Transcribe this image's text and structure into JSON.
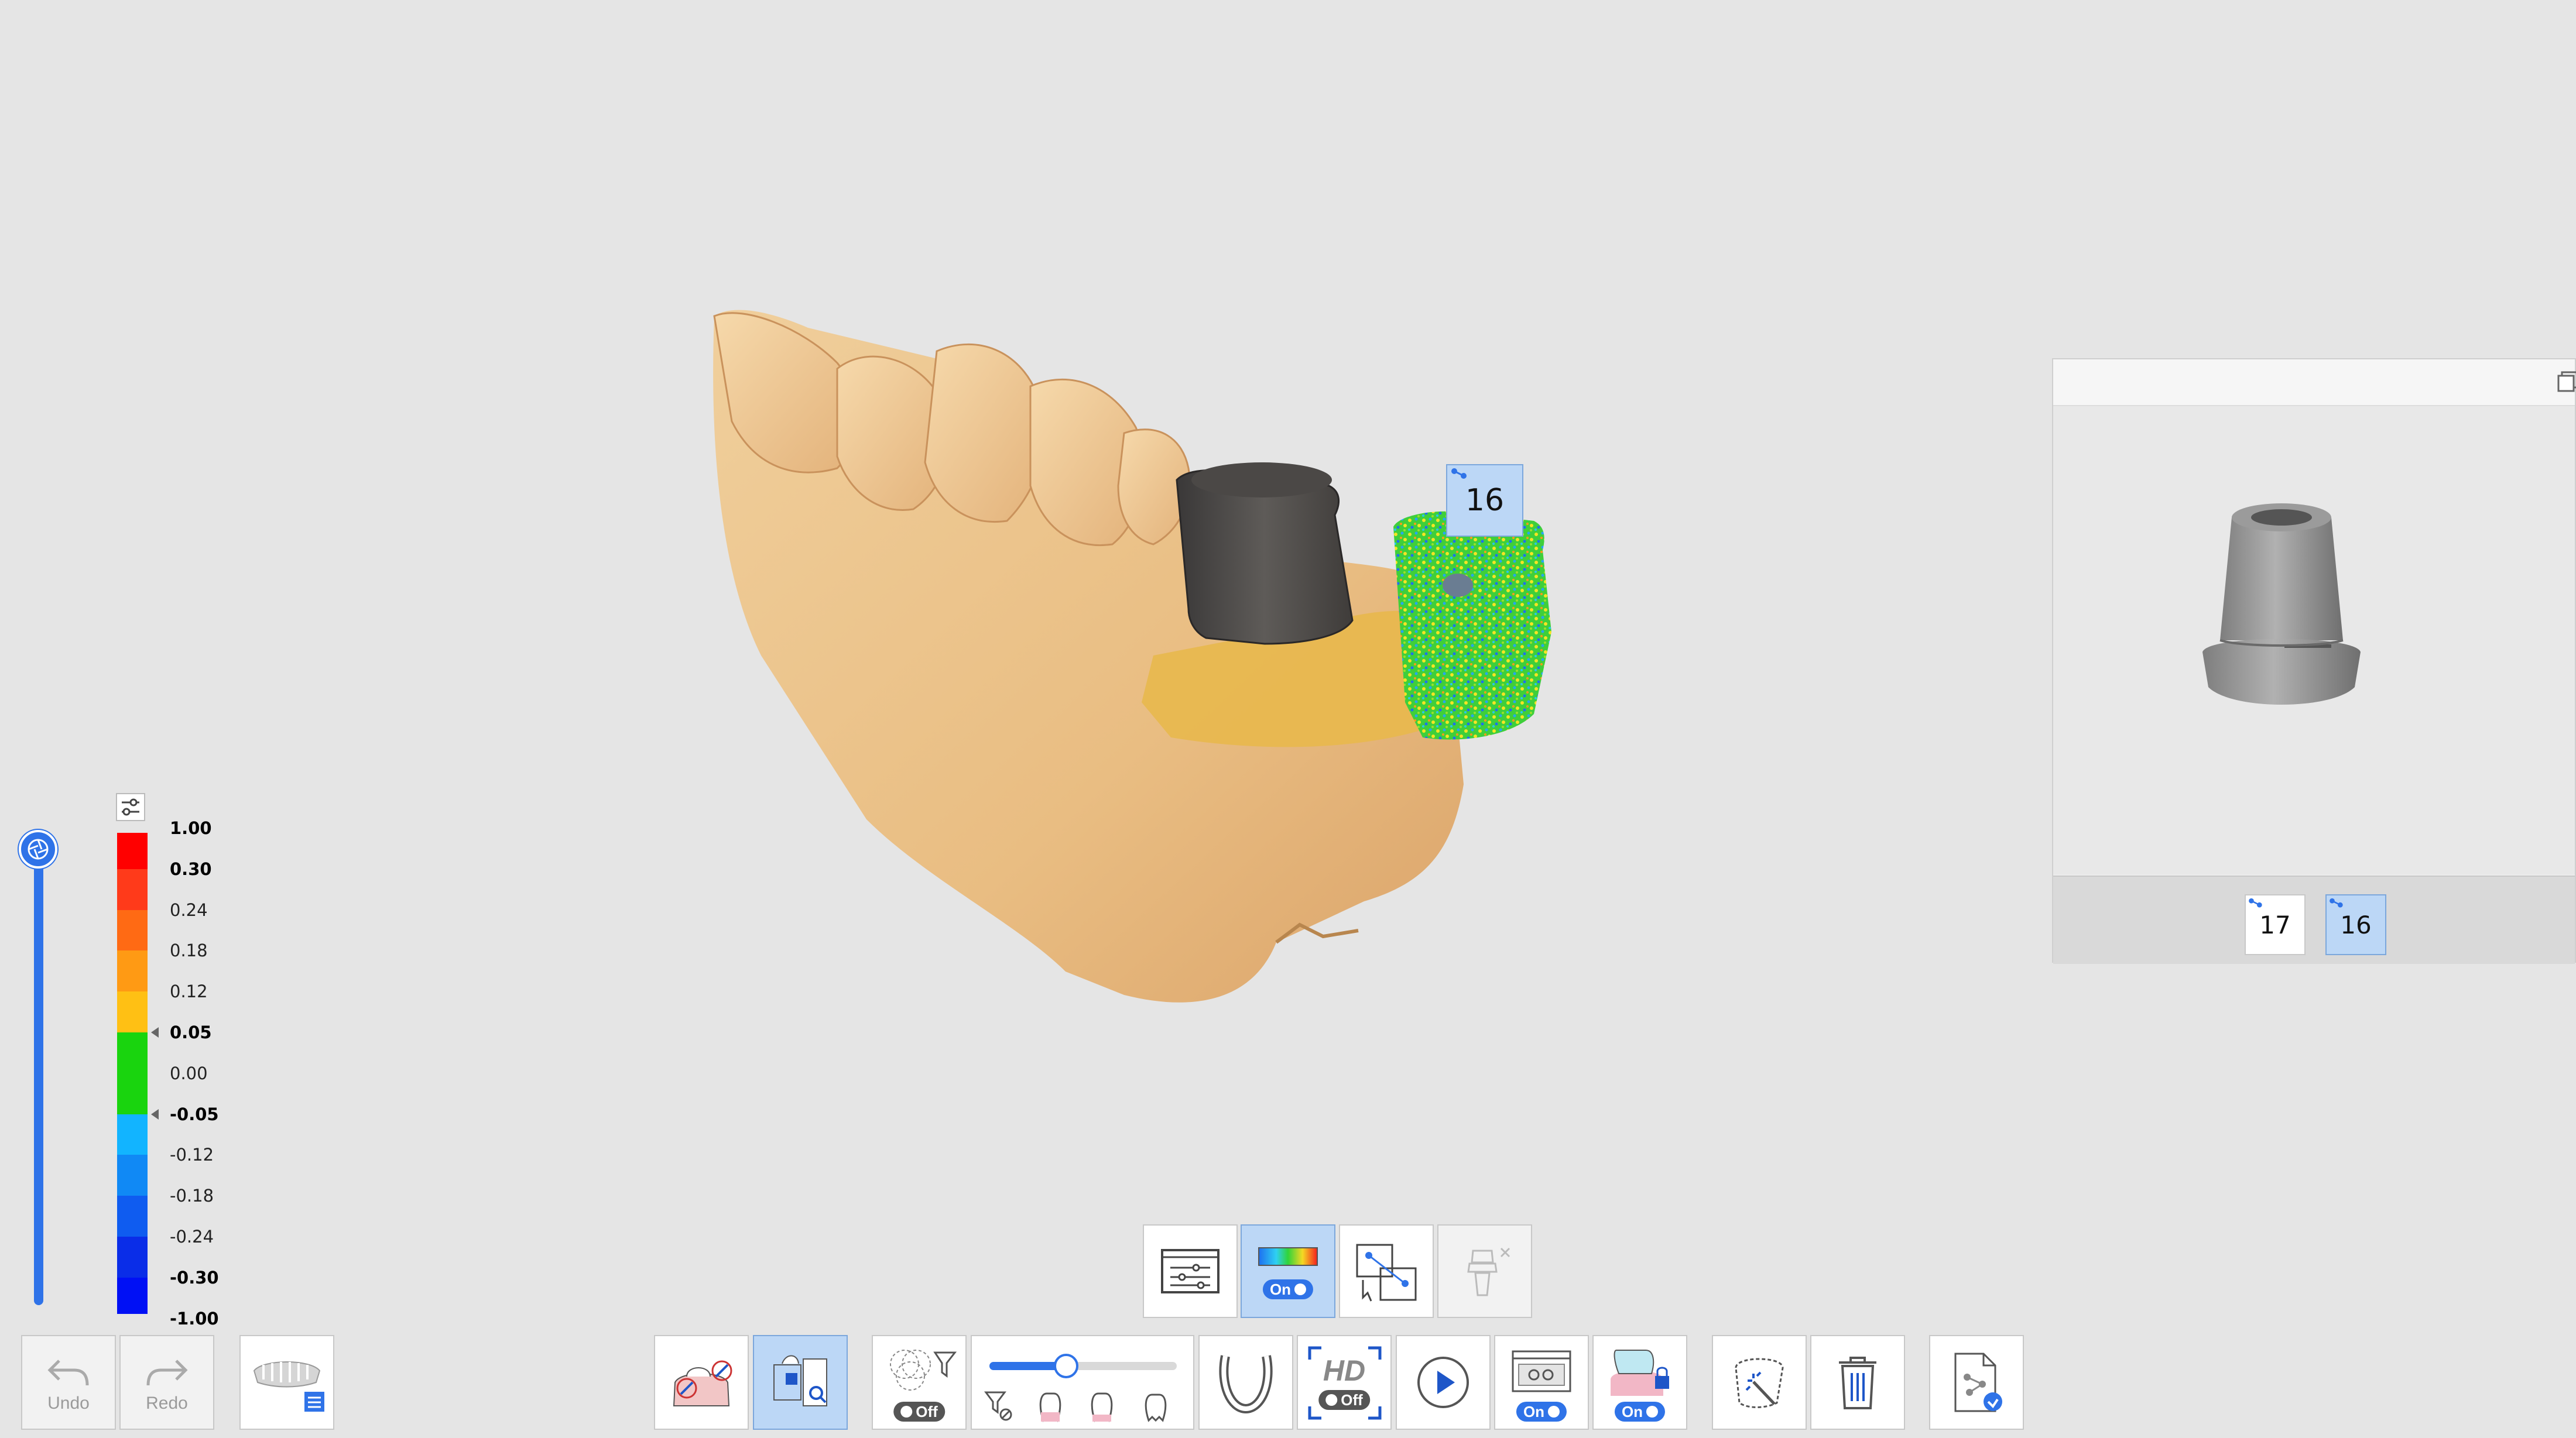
{
  "viewport": {
    "tooth_label": "16"
  },
  "legend": {
    "values": [
      "1.00",
      "0.30",
      "0.24",
      "0.18",
      "0.12",
      "0.05",
      "0.00",
      "-0.05",
      "-0.12",
      "-0.18",
      "-0.24",
      "-0.30",
      "-1.00"
    ],
    "bold_values": [
      "1.00",
      "0.30",
      "0.05",
      "-0.05",
      "-0.30",
      "-1.00"
    ],
    "colors": [
      "#ff0000",
      "#ff3a1a",
      "#ff6a14",
      "#ff9a14",
      "#ffc014",
      "#19d40e",
      "#19d40e",
      "#12b4ff",
      "#1089f5",
      "#0f5cf0",
      "#0a2de8",
      "#0010f5"
    ]
  },
  "bottom_left": {
    "undo_label": "Undo",
    "redo_label": "Redo"
  },
  "upper_toolbar": {
    "color_map_state": "On"
  },
  "main_toolbar": {
    "overlap_state": "Off",
    "hd_text": "HD",
    "hd_state": "Off",
    "view_option_state": "On",
    "lock_state": "On"
  },
  "right_panel": {
    "teeth": [
      {
        "label": "17",
        "selected": false
      },
      {
        "label": "16",
        "selected": true
      }
    ]
  },
  "colors": {
    "accent": "#2f73e8",
    "selection": "#bcd7f6",
    "background": "#e5e5e5"
  }
}
